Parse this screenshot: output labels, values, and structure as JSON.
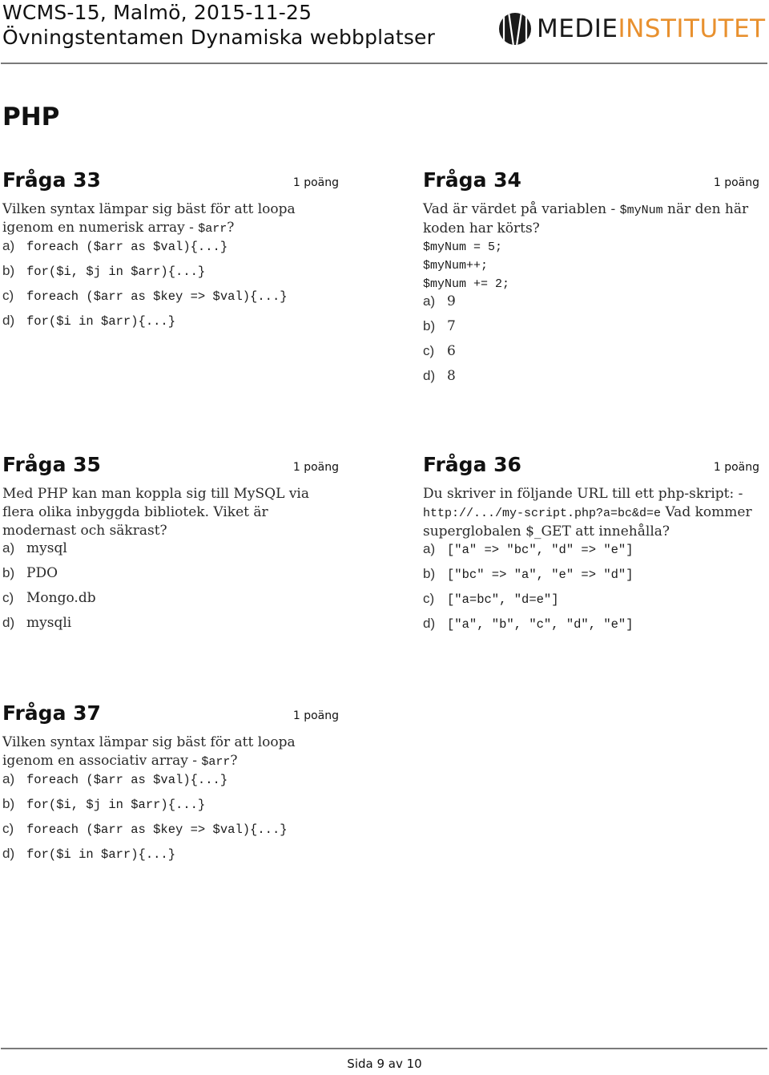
{
  "header": {
    "title_line1": "WCMS-15, Malmö, 2015-11-25",
    "title_line2": "Övningstentamen Dynamiska webbplatser",
    "logo": {
      "icon": "medieinstitutet-logo-icon",
      "text_dark": "MEDIE",
      "text_accent": "INSTITUTET",
      "accent_color": "#e8902e"
    }
  },
  "section": {
    "title": "PHP"
  },
  "questions": [
    {
      "title": "Fråga 33",
      "points": "1 poäng",
      "text_before_code": "Vilken syntax lämpar sig bäst för att loopa igenom en numerisk array - ",
      "inline_code": "$arr",
      "text_after_code": "?",
      "options": [
        {
          "letter": "a)",
          "value": "foreach ($arr as $val){...}"
        },
        {
          "letter": "b)",
          "value": "for($i, $j in $arr){...}"
        },
        {
          "letter": "c)",
          "value": "foreach ($arr as $key => $val){...}"
        },
        {
          "letter": "d)",
          "value": "for($i in $arr){...}"
        }
      ]
    },
    {
      "title": "Fråga 34",
      "points": "1 poäng",
      "text_before_code": "Vad är värdet på variablen - ",
      "inline_code": "$myNum",
      "text_after_code": " när den här koden har körts?",
      "code_lines": [
        "$myNum = 5;",
        "$myNum++;",
        "$myNum += 2;"
      ],
      "options": [
        {
          "letter": "a)",
          "value": "9"
        },
        {
          "letter": "b)",
          "value": "7"
        },
        {
          "letter": "c)",
          "value": "6"
        },
        {
          "letter": "d)",
          "value": "8"
        }
      ]
    },
    {
      "title": "Fråga 35",
      "points": "1 poäng",
      "text": "Med PHP kan man koppla sig till MySQL via flera olika inbyggda bibliotek. Viket är modernast och säkrast?",
      "options": [
        {
          "letter": "a)",
          "value": "mysql"
        },
        {
          "letter": "b)",
          "value": "PDO"
        },
        {
          "letter": "c)",
          "value": "Mongo.db"
        },
        {
          "letter": "d)",
          "value": "mysqli"
        }
      ]
    },
    {
      "title": "Fråga 36",
      "points": "1 poäng",
      "text_before_code": "Du skriver in följande URL till ett php-skript: - ",
      "inline_code": "http://.../my-script.php?a=bc&d=e",
      "text_after_code": " Vad kommer superglobalen $_GET att innehålla?",
      "options": [
        {
          "letter": "a)",
          "value": "[\"a\" => \"bc\", \"d\" => \"e\"]"
        },
        {
          "letter": "b)",
          "value": "[\"bc\" => \"a\", \"e\" => \"d\"]"
        },
        {
          "letter": "c)",
          "value": "[\"a=bc\", \"d=e\"]"
        },
        {
          "letter": "d)",
          "value": "[\"a\", \"b\", \"c\", \"d\", \"e\"]"
        }
      ]
    },
    {
      "title": "Fråga 37",
      "points": "1 poäng",
      "text_before_code": "Vilken syntax lämpar sig bäst för att loopa igenom en associativ array - ",
      "inline_code": "$arr",
      "text_after_code": "?",
      "options": [
        {
          "letter": "a)",
          "value": "foreach ($arr as $val){...}"
        },
        {
          "letter": "b)",
          "value": "for($i, $j in $arr){...}"
        },
        {
          "letter": "c)",
          "value": "foreach ($arr as $key => $val){...}"
        },
        {
          "letter": "d)",
          "value": "for($i in $arr){...}"
        }
      ]
    }
  ],
  "footer": {
    "page_label": "Sida 9 av 10"
  }
}
